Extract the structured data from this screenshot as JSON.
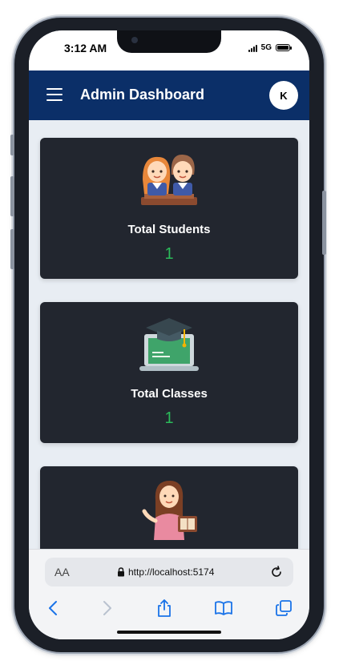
{
  "status_bar": {
    "time": "3:12 AM",
    "network": "5G"
  },
  "app_bar": {
    "title": "Admin Dashboard",
    "avatar_initial": "K",
    "menu_icon": "hamburger-menu-icon"
  },
  "cards": [
    {
      "label": "Total Students",
      "value": "1",
      "icon": "students-icon"
    },
    {
      "label": "Total Classes",
      "value": "1",
      "icon": "graduation-laptop-icon"
    },
    {
      "label": "",
      "value": "",
      "icon": "teacher-icon"
    }
  ],
  "browser": {
    "text_size_label": "AA",
    "url": "http://localhost:5174",
    "toolbar": [
      "back-icon",
      "forward-icon",
      "share-icon",
      "bookmarks-icon",
      "tabs-icon"
    ]
  },
  "colors": {
    "app_bar": "#0b2f68",
    "card_bg": "#22262f",
    "value_green": "#2bbb5a",
    "content_bg": "#e8edf3"
  }
}
